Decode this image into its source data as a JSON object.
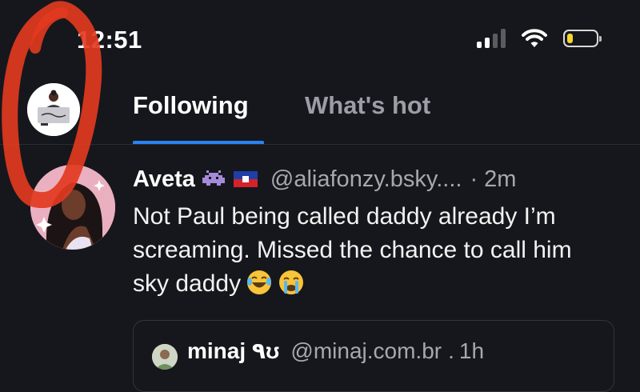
{
  "status_bar": {
    "time": "12:51",
    "signal_icon": "cellular-signal-icon",
    "wifi_icon": "wifi-icon",
    "battery_icon": "battery-low-icon",
    "battery_level": 0.2,
    "battery_color": "#f6d530"
  },
  "header": {
    "tabs": [
      {
        "label": "Following",
        "active": true
      },
      {
        "label": "What's hot",
        "active": false
      }
    ],
    "accent_color": "#2a82f4"
  },
  "post": {
    "author": "Aveta",
    "handle": "@aliafonzy.bsky....",
    "separator": "·",
    "time": "2m",
    "text": "Not Paul being called daddy already I’m screaming. Missed the chance to call him sky daddy",
    "author_emojis": [
      "alien-monster-emoji",
      "haiti-flag-emoji"
    ],
    "reaction_emojis": [
      "laughing-tears-emoji",
      "crying-emoji"
    ]
  },
  "quote": {
    "name": "minaj ٩ʊ",
    "handle": "@minaj.com.br",
    "separator": ".",
    "time": "1h"
  },
  "annotation": {
    "color": "#e23a1f"
  }
}
